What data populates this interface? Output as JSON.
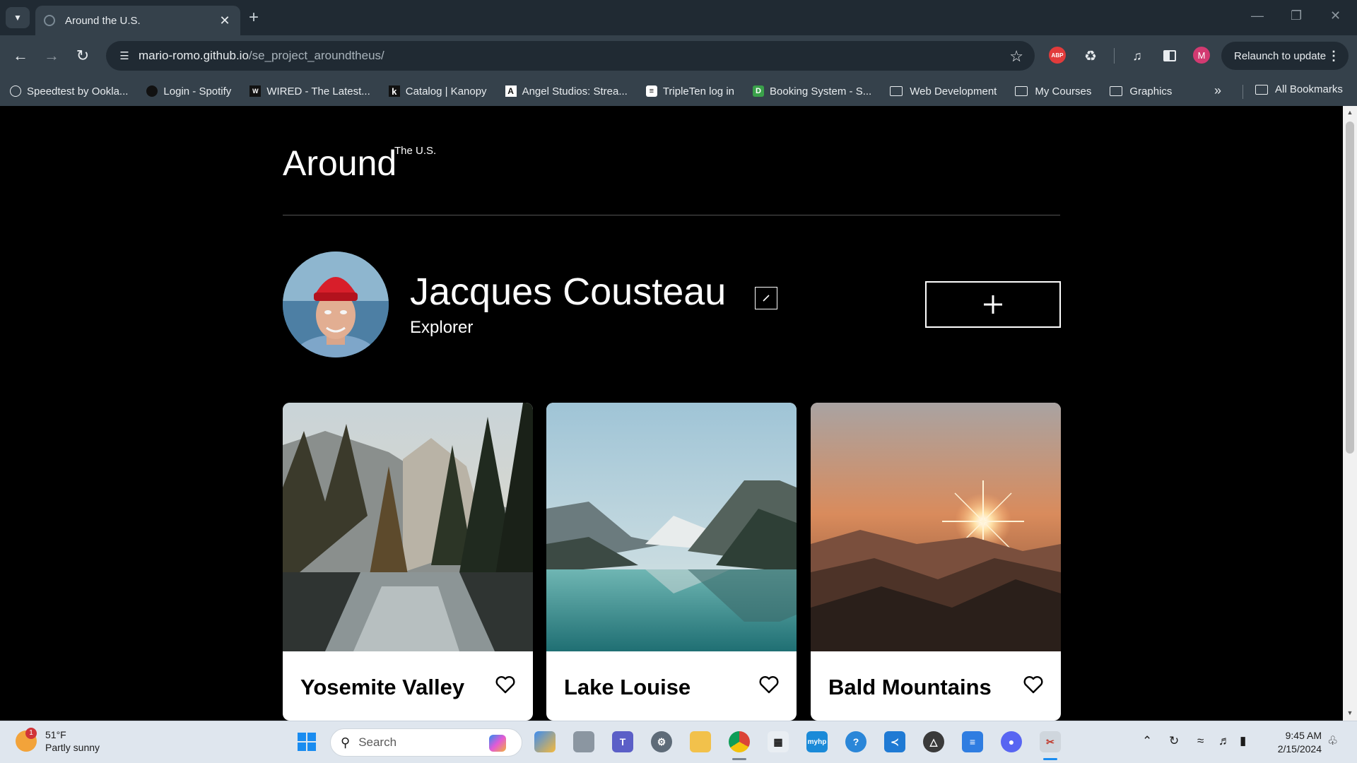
{
  "browser": {
    "tab_title": "Around the U.S.",
    "url_host": "mario-romo.github.io",
    "url_path": "/se_project_aroundtheus/",
    "relaunch_label": "Relaunch to update",
    "profile_initial": "M",
    "abp_label": "ABP",
    "bookmarks": [
      {
        "label": "Speedtest by Ookla...",
        "icon": "speedtest-icon"
      },
      {
        "label": "Login - Spotify",
        "icon": "spotify-icon"
      },
      {
        "label": "WIRED - The Latest...",
        "icon": "wired-icon"
      },
      {
        "label": "Catalog | Kanopy",
        "icon": "kanopy-icon"
      },
      {
        "label": "Angel Studios: Strea...",
        "icon": "angel-studios-icon"
      },
      {
        "label": "TripleTen log in",
        "icon": "tripleten-icon"
      },
      {
        "label": "Booking System - S...",
        "icon": "booking-icon"
      },
      {
        "label": "Web Development",
        "icon": "folder-icon"
      },
      {
        "label": "My Courses",
        "icon": "folder-icon"
      },
      {
        "label": "Graphics",
        "icon": "folder-icon"
      }
    ],
    "all_bookmarks_label": "All Bookmarks"
  },
  "page": {
    "logo_main": "Around",
    "logo_sup": "The U.S.",
    "profile": {
      "name": "Jacques Cousteau",
      "job": "Explorer"
    },
    "cards": [
      {
        "title": "Yosemite Valley"
      },
      {
        "title": "Lake Louise"
      },
      {
        "title": "Bald Mountains"
      }
    ]
  },
  "taskbar": {
    "weather_temp": "51°F",
    "weather_desc": "Partly sunny",
    "weather_badge": "1",
    "search_placeholder": "Search",
    "time": "9:45 AM",
    "date": "2/15/2024"
  },
  "colors": {
    "page_bg": "#000000",
    "chrome_dark": "#202a33",
    "chrome_toolbar": "#35414b",
    "card_bg": "#ffffff"
  }
}
